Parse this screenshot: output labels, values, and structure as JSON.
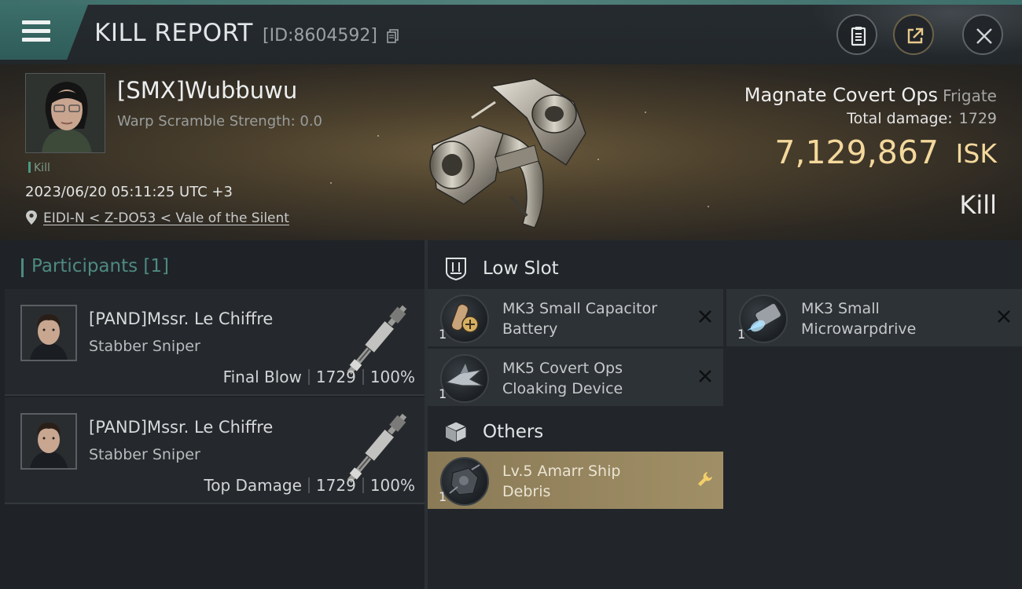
{
  "header": {
    "title": "KILL REPORT",
    "report_id": "[ID:8604592]",
    "icons": [
      "menu-icon",
      "copy-icon",
      "clipboard-icon",
      "share-icon",
      "close-icon"
    ]
  },
  "victim": {
    "name": "[SMX]Wubbuwu",
    "warp_scramble": "Warp Scramble Strength: 0.0",
    "tag": "Kill",
    "datetime": "2023/06/20 05:11:25 UTC +3",
    "location": "EIDI-N < Z-DO53 < Vale of the Silent"
  },
  "ship": {
    "name": "Magnate Covert Ops",
    "class": "Frigate",
    "total_damage_label": "Total damage:",
    "total_damage": "1729",
    "isk_value": "7,129,867",
    "isk_unit": "ISK",
    "result": "Kill"
  },
  "participants": {
    "title": "Participants [1]",
    "items": [
      {
        "name": "[PAND]Mssr. Le Chiffre",
        "ship": "Stabber Sniper",
        "role": "Final Blow",
        "damage": "1729",
        "percent": "100%"
      },
      {
        "name": "[PAND]Mssr. Le Chiffre",
        "ship": "Stabber Sniper",
        "role": "Top Damage",
        "damage": "1729",
        "percent": "100%"
      }
    ]
  },
  "low_slot": {
    "title": "Low Slot",
    "items": [
      {
        "qty": "1",
        "line1": "MK3 Small Capacitor",
        "line2": "Battery",
        "status": "destroyed"
      },
      {
        "qty": "1",
        "line1": "MK3 Small",
        "line2": "Microwarpdrive",
        "status": "destroyed"
      },
      {
        "qty": "1",
        "line1": "MK5 Covert Ops",
        "line2": "Cloaking Device",
        "status": "destroyed"
      }
    ]
  },
  "others": {
    "title": "Others",
    "items": [
      {
        "qty": "1",
        "line1": "Lv.5 Amarr Ship",
        "line2": "Debris",
        "status": "dropped"
      }
    ]
  },
  "colors": {
    "accent_teal": "#4e8a82",
    "isk_gold": "#f4d89c",
    "highlight_gold": "#a08f66"
  }
}
